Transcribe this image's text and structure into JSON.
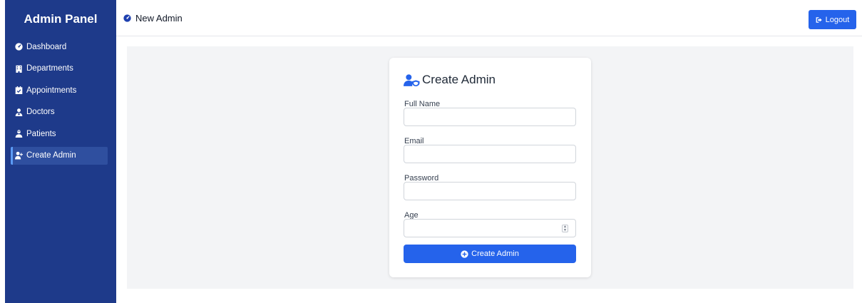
{
  "sidebar": {
    "brand": "Admin Panel",
    "items": [
      {
        "label": "Dashboard",
        "icon": "dashboard-icon"
      },
      {
        "label": "Departments",
        "icon": "building-icon"
      },
      {
        "label": "Appointments",
        "icon": "calendar-check-icon"
      },
      {
        "label": "Doctors",
        "icon": "user-doctor-icon"
      },
      {
        "label": "Patients",
        "icon": "user-injured-icon"
      },
      {
        "label": "Create Admin",
        "icon": "user-plus-icon",
        "active": true
      }
    ]
  },
  "header": {
    "title": "New Admin",
    "title_icon": "gauge-icon",
    "logout_label": "Logout",
    "logout_icon": "sign-out-icon"
  },
  "form": {
    "title": "Create Admin",
    "title_icon": "user-shield-icon",
    "fields": [
      {
        "label": "Full Name",
        "value": "",
        "type": "text"
      },
      {
        "label": "Email",
        "value": "",
        "type": "email"
      },
      {
        "label": "Password",
        "value": "",
        "type": "password"
      },
      {
        "label": "Age",
        "value": "",
        "type": "number"
      }
    ],
    "submit_label": "Create Admin",
    "submit_icon": "plus-circle-icon"
  },
  "colors": {
    "sidebar_bg": "#1e3a8a",
    "accent": "#2563eb",
    "content_bg": "#f3f4f6"
  }
}
